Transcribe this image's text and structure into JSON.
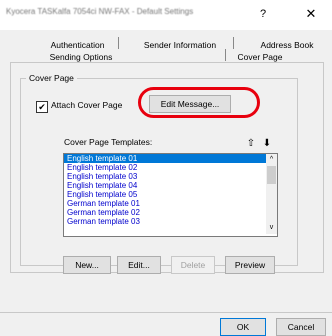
{
  "window": {
    "title": "Kyocera TASKalfa 7054ci NW-FAX - Default Settings",
    "help_label": "?",
    "close_label": "✕"
  },
  "tabs": {
    "row_back": [
      "Authentication",
      "Sender Information",
      "Address Book"
    ],
    "row_front": [
      "Sending Options",
      "Cover Page"
    ],
    "active": "Cover Page"
  },
  "cover_page": {
    "group_label": "Cover Page",
    "attach_checked": true,
    "check_mark": "✔",
    "attach_label": "Attach Cover Page",
    "edit_message_label": "Edit Message...",
    "templates_label": "Cover Page Templates:",
    "sort_up_icon": "⇧",
    "sort_down_icon": "⬇",
    "templates": [
      "English template 01",
      "English template 02",
      "English template 03",
      "English template 04",
      "English template 05",
      "German template 01",
      "German template 02",
      "German template 03"
    ],
    "selected_index": 0,
    "scroll_up_glyph": "^",
    "scroll_down_glyph": "v",
    "buttons": {
      "new": "New...",
      "edit": "Edit...",
      "delete": "Delete",
      "preview": "Preview"
    }
  },
  "footer": {
    "ok": "OK",
    "cancel": "Cancel"
  }
}
